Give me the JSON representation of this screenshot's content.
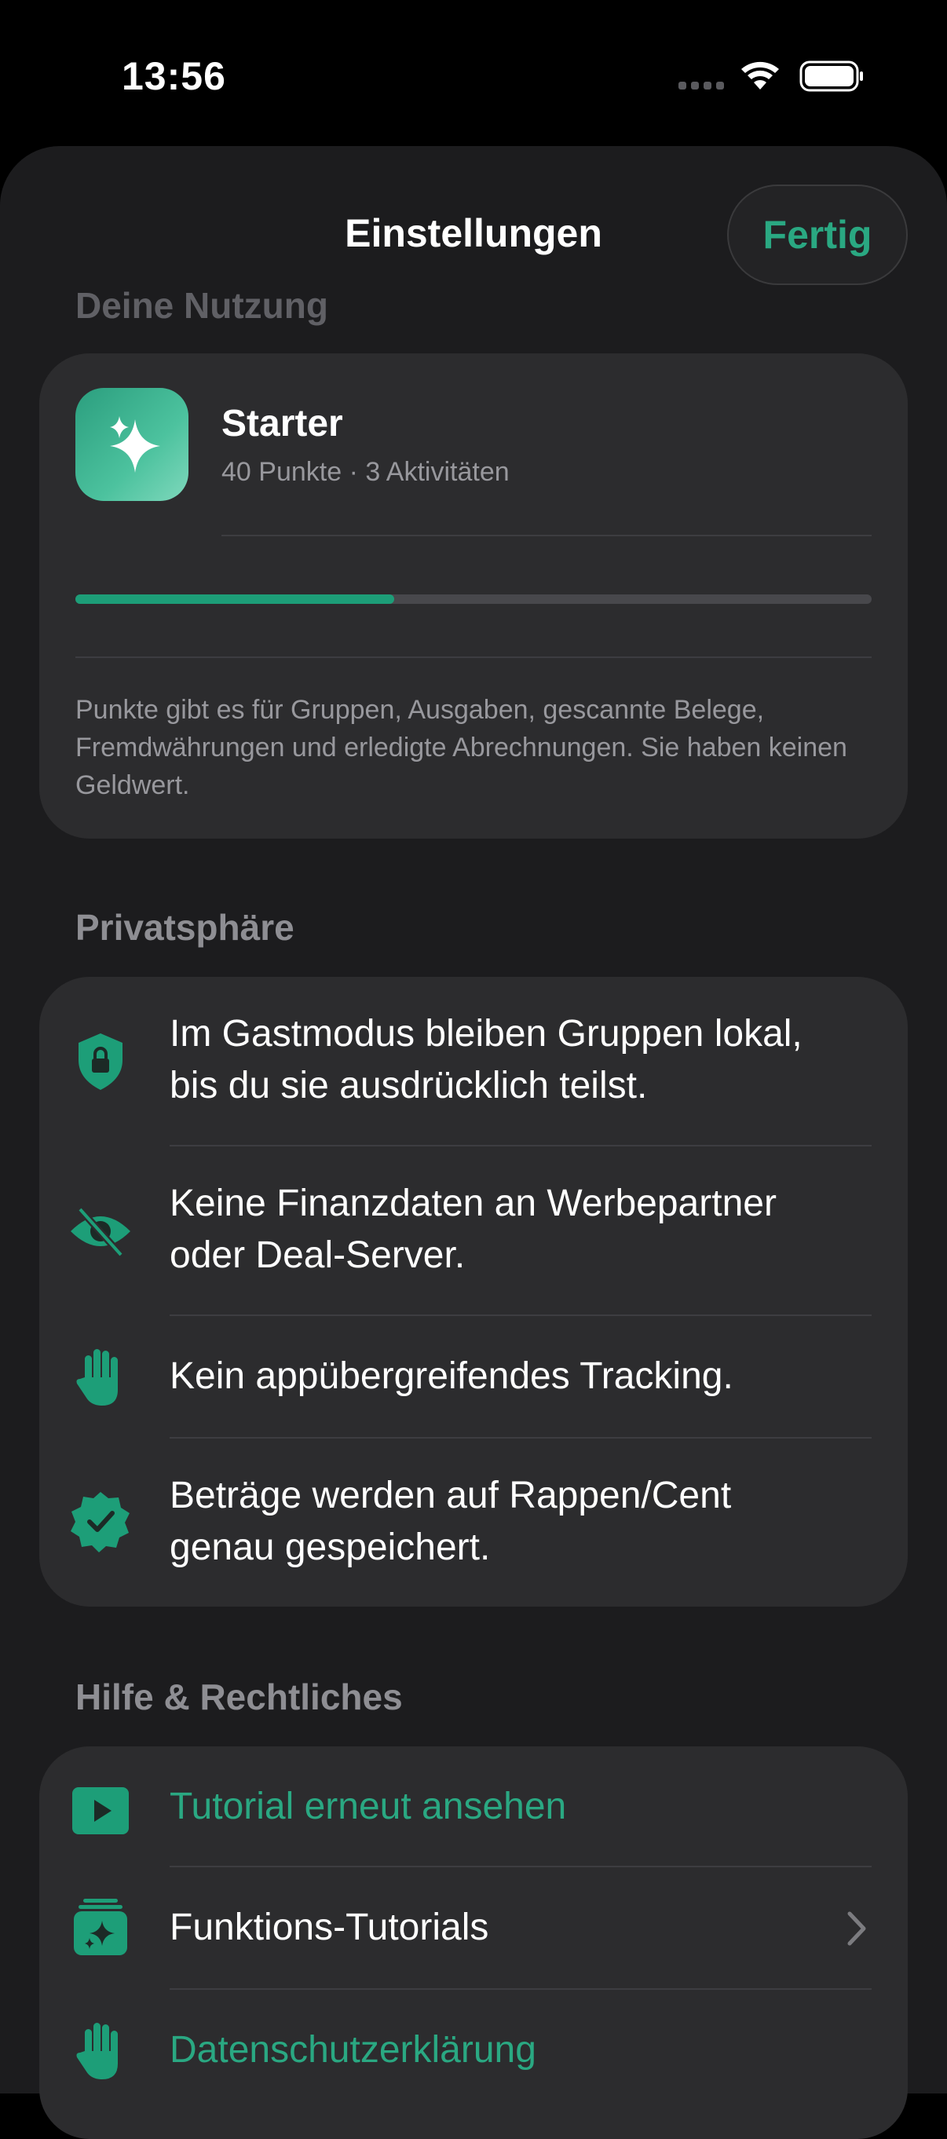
{
  "status_bar": {
    "time": "13:56"
  },
  "header": {
    "title": "Einstellungen",
    "done_label": "Fertig"
  },
  "usage": {
    "section_label": "Deine Nutzung",
    "tier_name": "Starter",
    "tier_subtitle": "40 Punkte · 3 Aktivitäten",
    "progress": 0.4,
    "note": "Punkte gibt es für Gruppen, Ausgaben, gescannte Belege, Fremdwährungen und erledigte Abrechnungen. Sie haben keinen Geldwert."
  },
  "privacy": {
    "section_label": "Privatsphäre",
    "items": [
      {
        "icon": "shield-lock-icon",
        "line1": "Im Gastmodus bleiben Gruppen lokal,",
        "line2": "bis du sie ausdrücklich teilst."
      },
      {
        "icon": "eye-slash-icon",
        "line1": "Keine Finanzdaten an Werbepartner",
        "line2": "oder Deal-Server."
      },
      {
        "icon": "hand-raised-icon",
        "line1": "Kein appübergreifendes Tracking."
      },
      {
        "icon": "checkmark-seal-icon",
        "line1": "Beträge werden auf Rappen/Cent",
        "line2": "genau gespeichert."
      }
    ]
  },
  "help": {
    "section_label": "Hilfe & Rechtliches",
    "items": [
      {
        "icon": "play-icon",
        "label": "Tutorial erneut ansehen"
      },
      {
        "icon": "sparkles-stack-icon",
        "label": "Funktions-Tutorials"
      },
      {
        "icon": "hand-raised-icon",
        "label": "Datenschutzerklärung"
      }
    ]
  },
  "colors": {
    "accent": "#2aa882",
    "card": "#2c2c2e",
    "sheet": "#1c1c1e",
    "secondary_text": "#98989d"
  }
}
